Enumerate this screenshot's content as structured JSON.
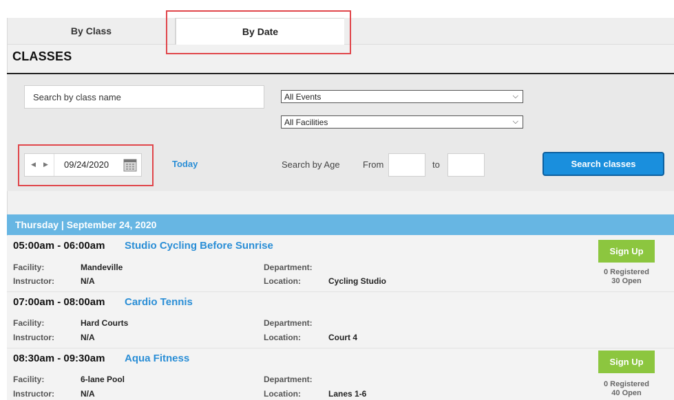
{
  "tabs": {
    "by_class": "By Class",
    "by_date": "By Date"
  },
  "page_title": "CLASSES",
  "filters": {
    "search_placeholder": "Search by class name",
    "events_select": "All Events",
    "facilities_select": "All Facilities",
    "date_value": "09/24/2020",
    "today_link": "Today",
    "age_label": "Search by Age",
    "from_label": "From",
    "to_label": "to",
    "search_button": "Search classes"
  },
  "day_header": "Thursday | September 24, 2020",
  "field_labels": {
    "facility": "Facility:",
    "instructor": "Instructor:",
    "department": "Department:",
    "location": "Location:"
  },
  "classes": [
    {
      "time": "05:00am - 06:00am",
      "name": "Studio Cycling Before Sunrise",
      "facility": "Mandeville",
      "instructor": "N/A",
      "department": "",
      "location": "Cycling Studio",
      "signup_label": "Sign Up",
      "registered": "0 Registered",
      "open": "30 Open"
    },
    {
      "time": "07:00am - 08:00am",
      "name": "Cardio Tennis",
      "facility": "Hard Courts",
      "instructor": "N/A",
      "department": "",
      "location": "Court 4"
    },
    {
      "time": "08:30am - 09:30am",
      "name": "Aqua Fitness",
      "facility": "6-lane Pool",
      "instructor": "N/A",
      "department": "",
      "location": "Lanes 1-6",
      "signup_label": "Sign Up",
      "registered": "0 Registered",
      "open": "40 Open"
    }
  ],
  "colors": {
    "accent_blue": "#2a8ed6",
    "day_header": "#67b6e3",
    "signup_green": "#8cc63f",
    "highlight_red": "#e0454a"
  }
}
